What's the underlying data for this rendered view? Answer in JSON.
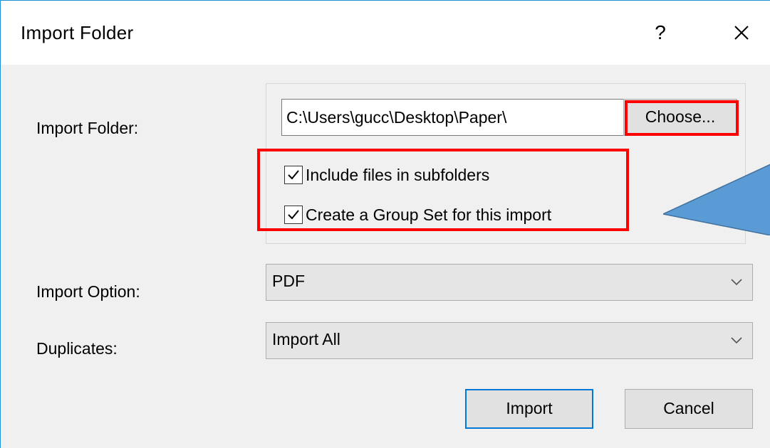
{
  "dialog": {
    "title": "Import Folder",
    "help_label": "?",
    "close_icon": "close-icon"
  },
  "form": {
    "folder_label": "Import Folder:",
    "folder_path": "C:\\Users\\gucc\\Desktop\\Paper\\",
    "choose_label": "Choose...",
    "include_subfolders_label": "Include files in subfolders",
    "include_subfolders_checked": true,
    "group_set_label": "Create a Group Set for this import",
    "group_set_checked": true,
    "import_option_label": "Import Option:",
    "import_option_value": "PDF",
    "duplicates_label": "Duplicates:",
    "duplicates_value": "Import All"
  },
  "buttons": {
    "import_label": "Import",
    "cancel_label": "Cancel"
  },
  "colors": {
    "accent": "#0078d7",
    "highlight": "#ff0000",
    "callout": "#5b9bd5"
  }
}
